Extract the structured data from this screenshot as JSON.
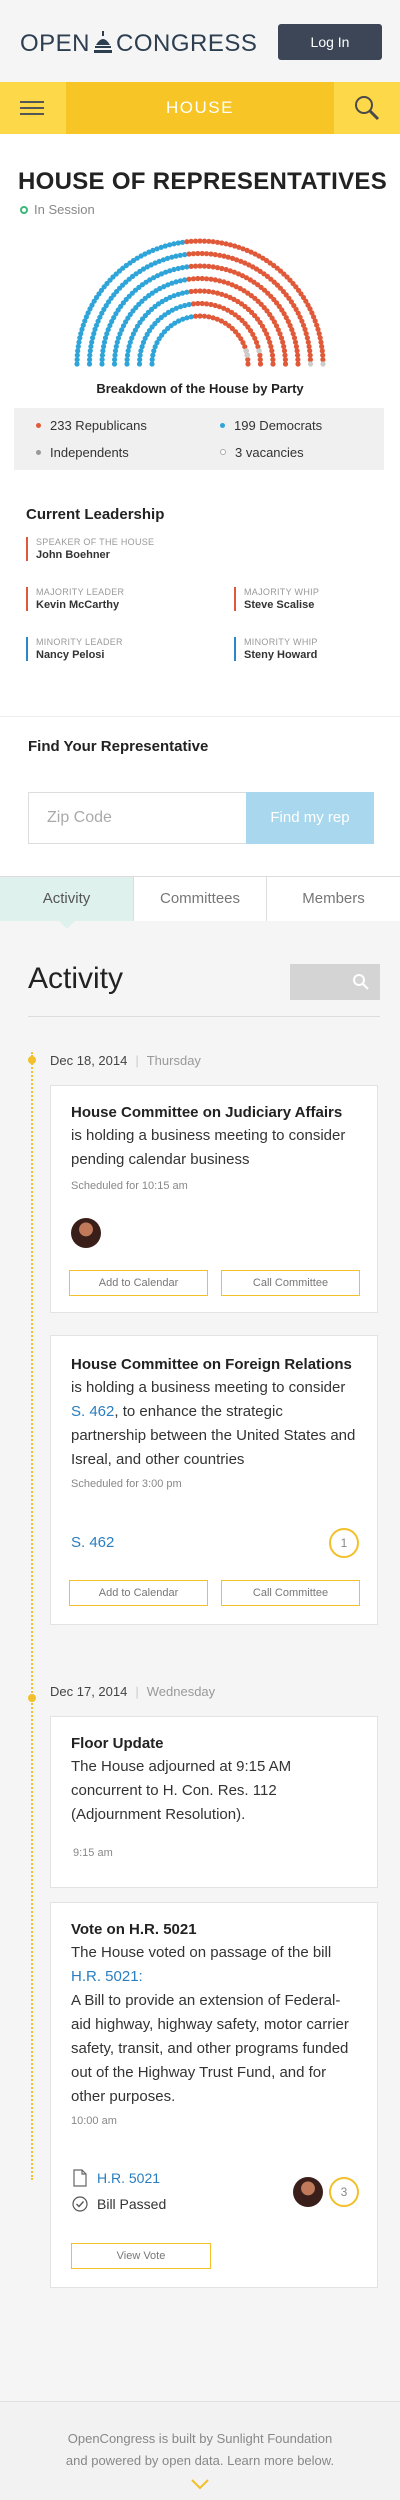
{
  "header": {
    "logo_text": "OPEN ⌂ CONGRESS",
    "logo_left": "OPEN",
    "logo_right": "CONGRESS",
    "login_label": "Log In"
  },
  "nav": {
    "title": "HOUSE",
    "menu_icon": "hamburger-icon",
    "search_icon": "search-icon"
  },
  "house": {
    "title": "HOUSE OF REPRESENTATIVES",
    "status": "In Session",
    "status_color": "#3cb878",
    "breakdown_label": "Breakdown of the House by Party",
    "parties": [
      {
        "label": "233 Republicans",
        "count": 233,
        "color": "#e05a3a"
      },
      {
        "label": "199 Democrats",
        "count": 199,
        "color": "#2fa4d8"
      },
      {
        "label": "Independents",
        "count": 0,
        "color": "#999999"
      },
      {
        "label": "3 vacancies",
        "count": 3,
        "color": "#cccccc"
      }
    ]
  },
  "leadership": {
    "title": "Current Leadership",
    "leaders": [
      {
        "role": "SPEAKER OF THE HOUSE",
        "name": "John Boehner",
        "party": "R"
      },
      {
        "role": "MAJORITY LEADER",
        "name": "Kevin McCarthy",
        "party": "R"
      },
      {
        "role": "MAJORITY WHIP",
        "name": "Steve Scalise",
        "party": "R"
      },
      {
        "role": "MINORITY LEADER",
        "name": "Nancy Pelosi",
        "party": "D"
      },
      {
        "role": "MINORITY WHIP",
        "name": "Steny Howard",
        "party": "D"
      }
    ]
  },
  "find_rep": {
    "title": "Find Your Representative",
    "zip_placeholder": "Zip Code",
    "button_label": "Find my rep"
  },
  "tabs": [
    "Activity",
    "Committees",
    "Members"
  ],
  "activity": {
    "title": "Activity",
    "days": [
      {
        "date": "Dec 18, 2014",
        "weekday": "Thursday",
        "items": [
          {
            "title": "House Committee on Judiciary Affairs",
            "body": "is holding a business meeting to consider pending calendar business",
            "scheduled": "Scheduled for 10:15 am",
            "add_label": "Add to Calendar",
            "call_label": "Call Committee"
          },
          {
            "title": "House Committee on Foreign Relations",
            "body_pre": "is holding a business meeting to consider",
            "body_link": "S. 462",
            "body_post": ", to enhance the strategic partnership between the United States and Isreal, and other countries",
            "scheduled": "Scheduled for 3:00 pm",
            "bill_link": "S. 462",
            "comment_count": "1",
            "add_label": "Add to Calendar",
            "call_label": "Call Committee"
          }
        ]
      },
      {
        "date": "Dec 17, 2014",
        "weekday": "Wednesday",
        "items": [
          {
            "title": "Floor Update",
            "body": "The House adjourned at 9:15 AM concurrent to H. Con. Res. 112 (Adjournment Resolution).",
            "time": "9:15 am"
          },
          {
            "title": "Vote on H.R. 5021",
            "body_pre": "The House voted on passage of the bill",
            "body_link": "H.R. 5021:",
            "body_post": "A Bill to provide an extension of Federal-aid highway, highway safety, motor carrier safety, transit, and other programs funded out of the Highway Trust Fund, and for other purposes.",
            "time": "10:00 am",
            "bill_link": "H.R. 5021",
            "status": "Bill Passed",
            "comment_count": "3",
            "view_label": "View Vote"
          }
        ]
      }
    ]
  },
  "footer": {
    "line1": "OpenCongress is built by Sunlight Foundation",
    "line2": "and powered by open data. Learn more below."
  }
}
